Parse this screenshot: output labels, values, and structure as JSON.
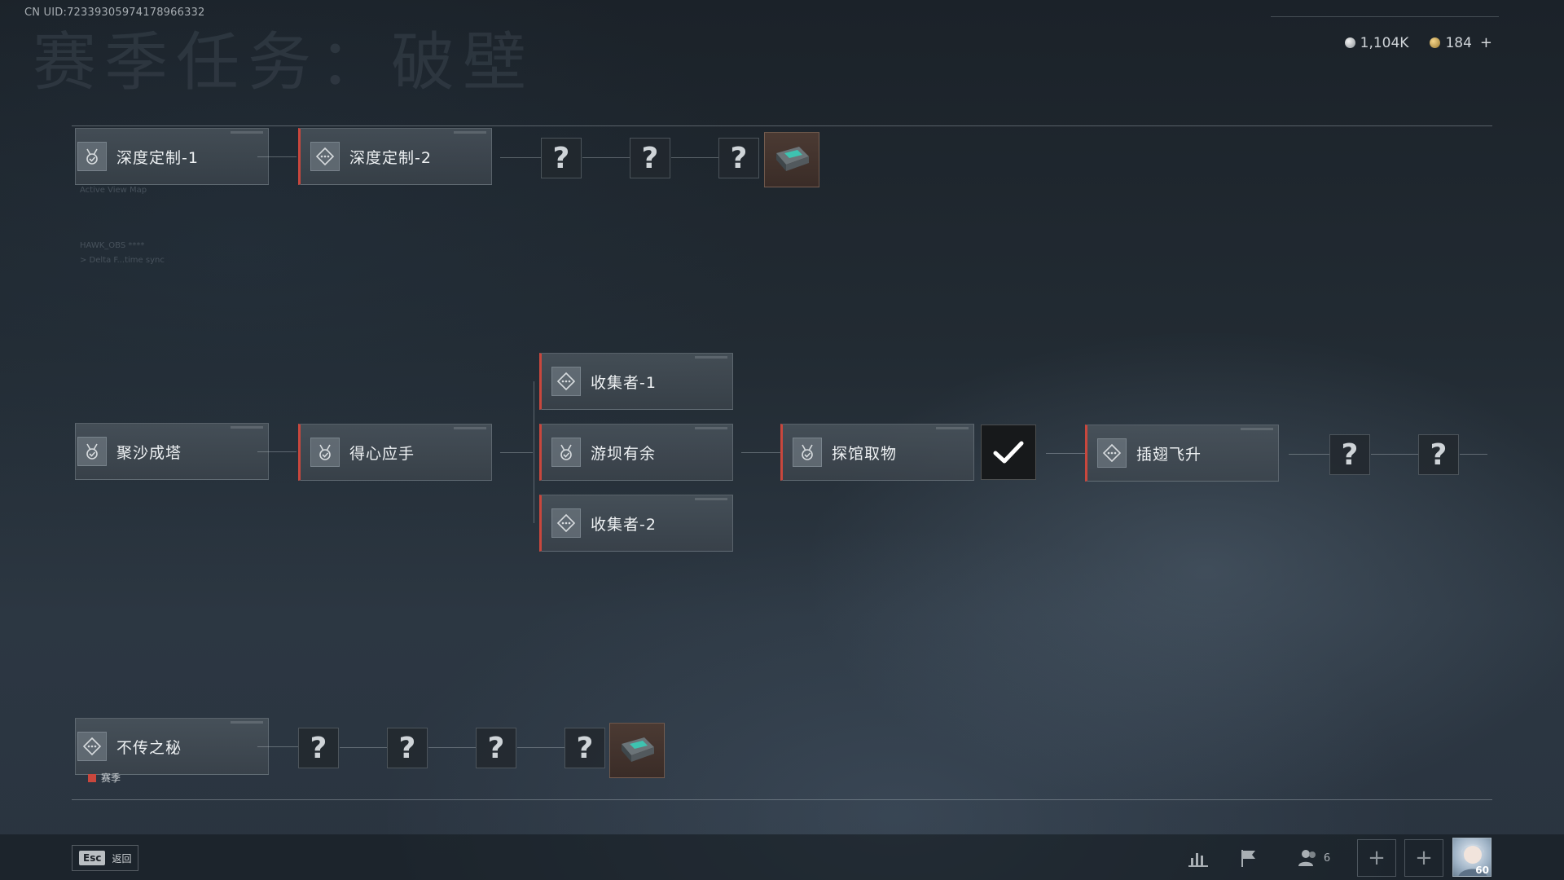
{
  "header": {
    "uid": "CN UID:7233930597417896633​2",
    "title": "赛季任务：破壁",
    "currency": [
      {
        "icon": "silver-coin-icon",
        "value": "1,104K"
      },
      {
        "icon": "gold-coin-icon",
        "value": "184"
      }
    ],
    "add_label": "+"
  },
  "deco": {
    "active_view_map": "Active View Map",
    "hawk": "HAWK_OBS ****",
    "delta": "> Delta F...time sync"
  },
  "tasks": {
    "row1": [
      {
        "label": "深度定制-1",
        "icon": "medal-check-icon",
        "accent": false
      },
      {
        "label": "深度定制-2",
        "icon": "diamond-dots-icon",
        "accent": true
      }
    ],
    "row2_start": [
      {
        "label": "聚沙成塔",
        "icon": "medal-check-icon",
        "accent": false
      },
      {
        "label": "得心应手",
        "icon": "medal-check-icon",
        "accent": true
      }
    ],
    "row2_branch": [
      {
        "label": "收集者-1",
        "icon": "diamond-dots-icon",
        "accent": true
      },
      {
        "label": "游坝有余",
        "icon": "medal-check-icon",
        "accent": true
      },
      {
        "label": "收集者-2",
        "icon": "diamond-dots-icon",
        "accent": true
      }
    ],
    "row2_end": [
      {
        "label": "探馆取物",
        "icon": "medal-check-icon",
        "accent": true
      },
      {
        "label": "插翅飞升",
        "icon": "diamond-dots-icon",
        "accent": true
      }
    ],
    "row3": [
      {
        "label": "不传之秘",
        "icon": "diamond-dots-icon",
        "accent": false
      }
    ]
  },
  "unknown_symbol": "?",
  "season_tag": "赛季",
  "footer": {
    "esc_key": "Esc",
    "back_label": "返回",
    "team_count": "6",
    "avatar_level": "60"
  }
}
